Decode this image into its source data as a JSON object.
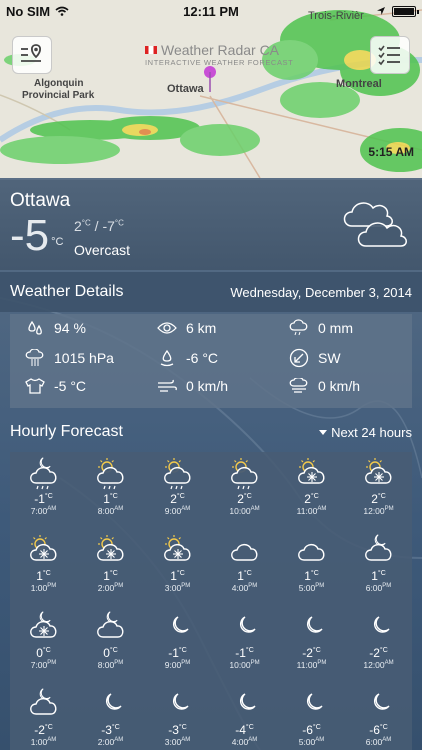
{
  "status_bar": {
    "carrier": "No SIM",
    "time": "12:11 PM"
  },
  "map": {
    "brand_name": "Weather Radar CA",
    "brand_tagline": "INTERACTIVE WEATHER FORECAST",
    "labels": {
      "ottawa": "Ottawa",
      "montreal": "Montreal",
      "trois_rivieres": "Trois-Rivièr",
      "algonquin": "Algonquin",
      "park": "Provincial Park"
    },
    "timestamp": "5:15 AM"
  },
  "current": {
    "city": "Ottawa",
    "temp": "-5",
    "temp_unit": "°C",
    "high": "2",
    "low": "-7",
    "unit": "°C",
    "hilo_sep": "/",
    "condition": "Overcast"
  },
  "details": {
    "title": "Weather Details",
    "date": "Wednesday, December 3, 2014",
    "humidity": "94 %",
    "visibility": "6 km",
    "precip": "0 mm",
    "pressure": "1015 hPa",
    "dewpoint": "-6 °C",
    "wind_dir": "SW",
    "feels_like": "-5 °C",
    "wind_speed": "0 km/h",
    "gust": "0 km/h"
  },
  "hourly": {
    "title": "Hourly Forecast",
    "range_label": "Next 24 hours",
    "unit": "°C",
    "items": [
      {
        "temp": "-1",
        "time": "7:00",
        "ampm": "AM",
        "icon": "night-cloud-rain-icon"
      },
      {
        "temp": "1",
        "time": "8:00",
        "ampm": "AM",
        "icon": "sun-cloud-rain-icon"
      },
      {
        "temp": "2",
        "time": "9:00",
        "ampm": "AM",
        "icon": "sun-cloud-rain-icon"
      },
      {
        "temp": "2",
        "time": "10:00",
        "ampm": "AM",
        "icon": "sun-cloud-rain-icon"
      },
      {
        "temp": "2",
        "time": "11:00",
        "ampm": "AM",
        "icon": "sun-cloud-snow-icon"
      },
      {
        "temp": "2",
        "time": "12:00",
        "ampm": "PM",
        "icon": "sun-cloud-snow-icon"
      },
      {
        "temp": "1",
        "time": "1:00",
        "ampm": "PM",
        "icon": "sun-cloud-snow-icon"
      },
      {
        "temp": "1",
        "time": "2:00",
        "ampm": "PM",
        "icon": "sun-cloud-snow-icon"
      },
      {
        "temp": "1",
        "time": "3:00",
        "ampm": "PM",
        "icon": "sun-cloud-snow-icon"
      },
      {
        "temp": "1",
        "time": "4:00",
        "ampm": "PM",
        "icon": "cloud-icon"
      },
      {
        "temp": "1",
        "time": "5:00",
        "ampm": "PM",
        "icon": "cloud-icon"
      },
      {
        "temp": "1",
        "time": "6:00",
        "ampm": "PM",
        "icon": "night-cloud-icon"
      },
      {
        "temp": "0",
        "time": "7:00",
        "ampm": "PM",
        "icon": "night-cloud-snow-icon"
      },
      {
        "temp": "0",
        "time": "8:00",
        "ampm": "PM",
        "icon": "night-cloud-icon"
      },
      {
        "temp": "-1",
        "time": "9:00",
        "ampm": "PM",
        "icon": "moon-icon"
      },
      {
        "temp": "-1",
        "time": "10:00",
        "ampm": "PM",
        "icon": "moon-icon"
      },
      {
        "temp": "-2",
        "time": "11:00",
        "ampm": "PM",
        "icon": "moon-icon"
      },
      {
        "temp": "-2",
        "time": "12:00",
        "ampm": "AM",
        "icon": "moon-icon"
      },
      {
        "temp": "-2",
        "time": "1:00",
        "ampm": "AM",
        "icon": "night-cloud-icon"
      },
      {
        "temp": "-3",
        "time": "2:00",
        "ampm": "AM",
        "icon": "moon-icon"
      },
      {
        "temp": "-3",
        "time": "3:00",
        "ampm": "AM",
        "icon": "moon-icon"
      },
      {
        "temp": "-4",
        "time": "4:00",
        "ampm": "AM",
        "icon": "moon-icon"
      },
      {
        "temp": "-6",
        "time": "5:00",
        "ampm": "AM",
        "icon": "moon-icon"
      },
      {
        "temp": "-6",
        "time": "6:00",
        "ampm": "AM",
        "icon": "moon-icon"
      }
    ]
  }
}
